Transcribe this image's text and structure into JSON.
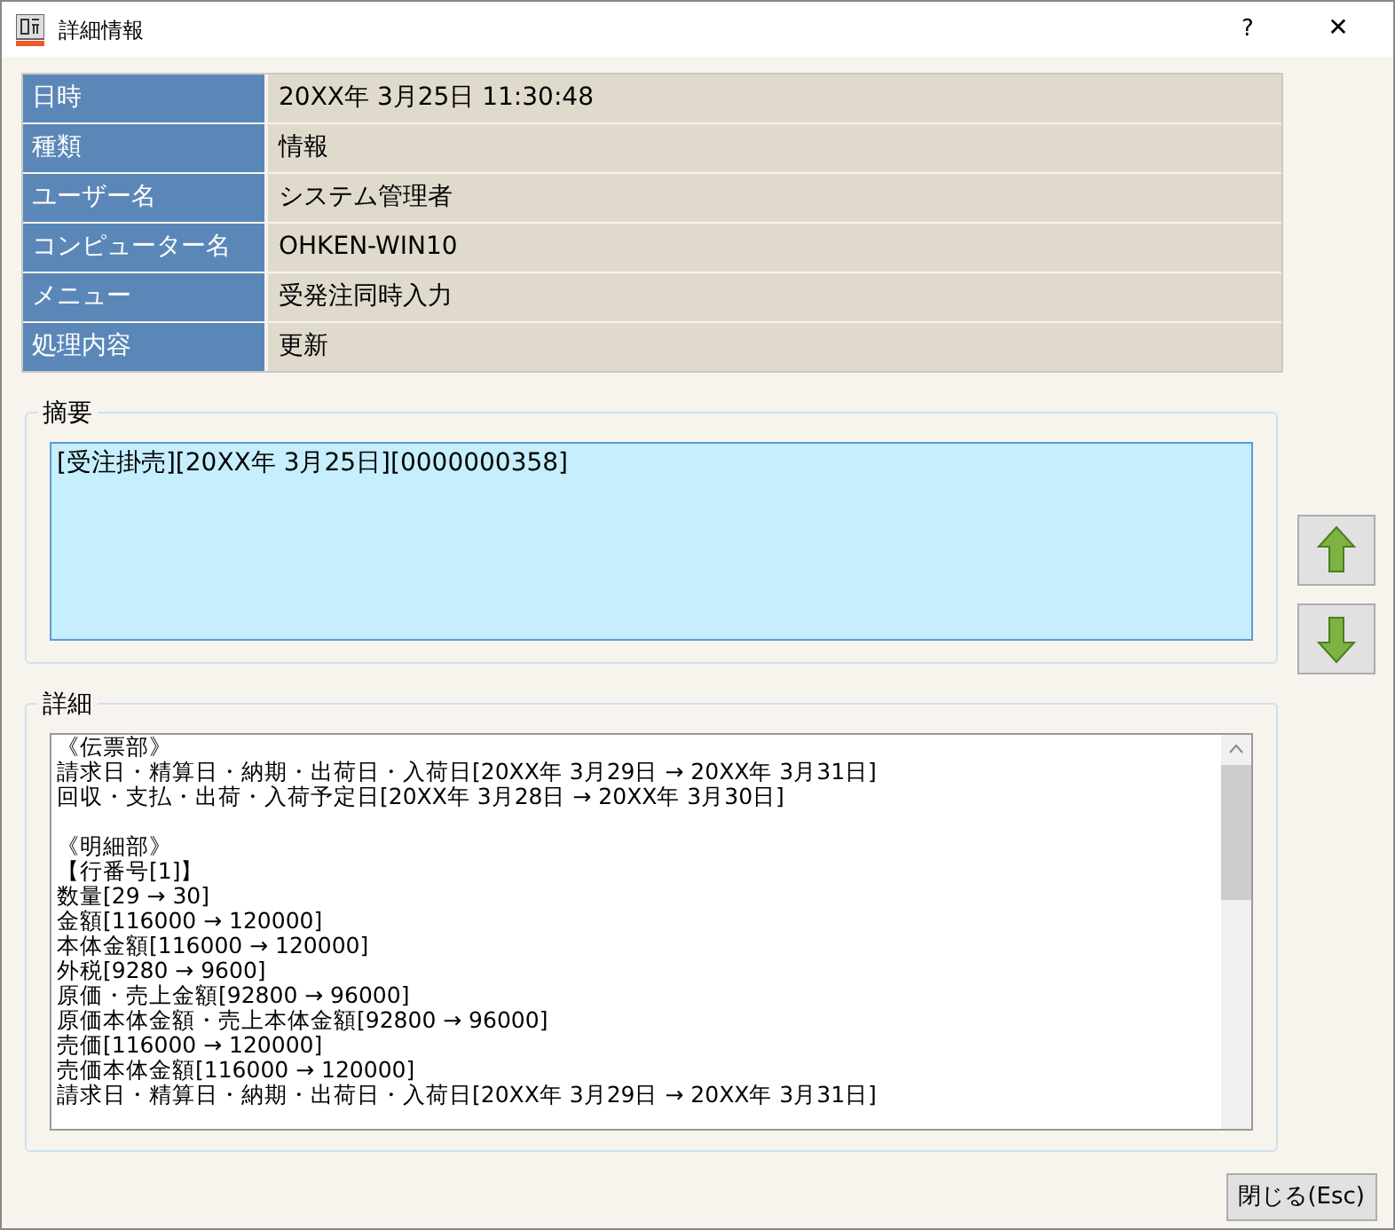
{
  "window": {
    "title": "詳細情報",
    "help": "?",
    "close": "✕"
  },
  "info_rows": [
    {
      "label": "日時",
      "value": "20XX年 3月25日 11:30:48"
    },
    {
      "label": "種類",
      "value": "情報"
    },
    {
      "label": "ユーザー名",
      "value": "システム管理者"
    },
    {
      "label": "コンピューター名",
      "value": "OHKEN-WIN10"
    },
    {
      "label": "メニュー",
      "value": "受発注同時入力"
    },
    {
      "label": "処理内容",
      "value": "更新"
    }
  ],
  "summary": {
    "legend": "摘要",
    "text": "[受注掛売][20XX年 3月25日][0000000358]"
  },
  "details": {
    "legend": "詳細",
    "sections": [
      {
        "lines": [
          "《伝票部》",
          "請求日・精算日・納期・出荷日・入荷日[20XX年 3月29日 → 20XX年 3月31日]",
          "回収・支払・出荷・入荷予定日[20XX年 3月28日 → 20XX年 3月30日]"
        ]
      },
      {
        "lines": [
          "《明細部》",
          "【行番号[1]】",
          "数量[29 → 30]",
          "金額[116000 → 120000]",
          "本体金額[116000 → 120000]",
          "外税[9280 → 9600]",
          "原価・売上金額[92800 → 96000]",
          "原価本体金額・売上本体金額[92800 → 96000]",
          "売価[116000 → 120000]",
          "売価本体金額[116000 → 120000]",
          "請求日・精算日・納期・出荷日・入荷日[20XX年 3月29日 → 20XX年 3月31日]"
        ]
      }
    ]
  },
  "close_button": "閉じる(Esc)"
}
